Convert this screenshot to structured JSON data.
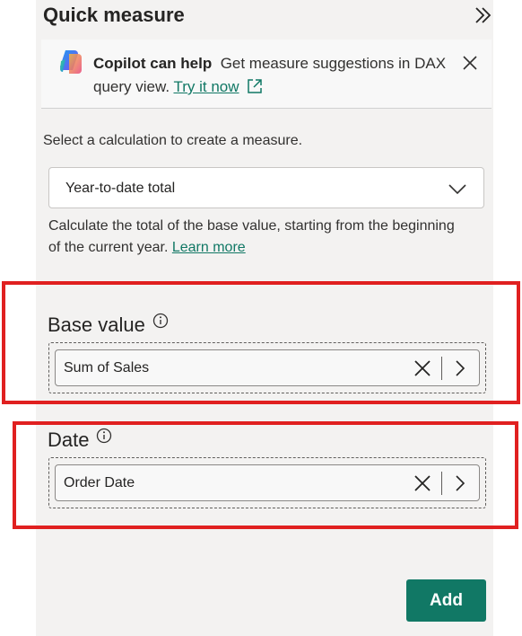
{
  "pane": {
    "title": "Quick measure",
    "collapse_icon": "double-chevron-right-icon"
  },
  "copilot": {
    "heading": "Copilot can help",
    "body": "Get measure suggestions in DAX query view.",
    "link": "Try it now",
    "logo_icon": "copilot-logo",
    "link_icon": "external-link-icon",
    "close_icon": "close-icon"
  },
  "calculation": {
    "instruction": "Select a calculation to create a measure.",
    "selected": "Year-to-date total",
    "description": "Calculate the total of the base value, starting from the beginning of the current year.",
    "learn_more": "Learn more"
  },
  "fields": {
    "base_value": {
      "label": "Base value",
      "value": "Sum of Sales"
    },
    "date": {
      "label": "Date",
      "value": "Order Date"
    }
  },
  "actions": {
    "add": "Add"
  },
  "colors": {
    "accent": "#117865",
    "pane_background": "#f3f2f1",
    "highlight": "#e02020"
  }
}
